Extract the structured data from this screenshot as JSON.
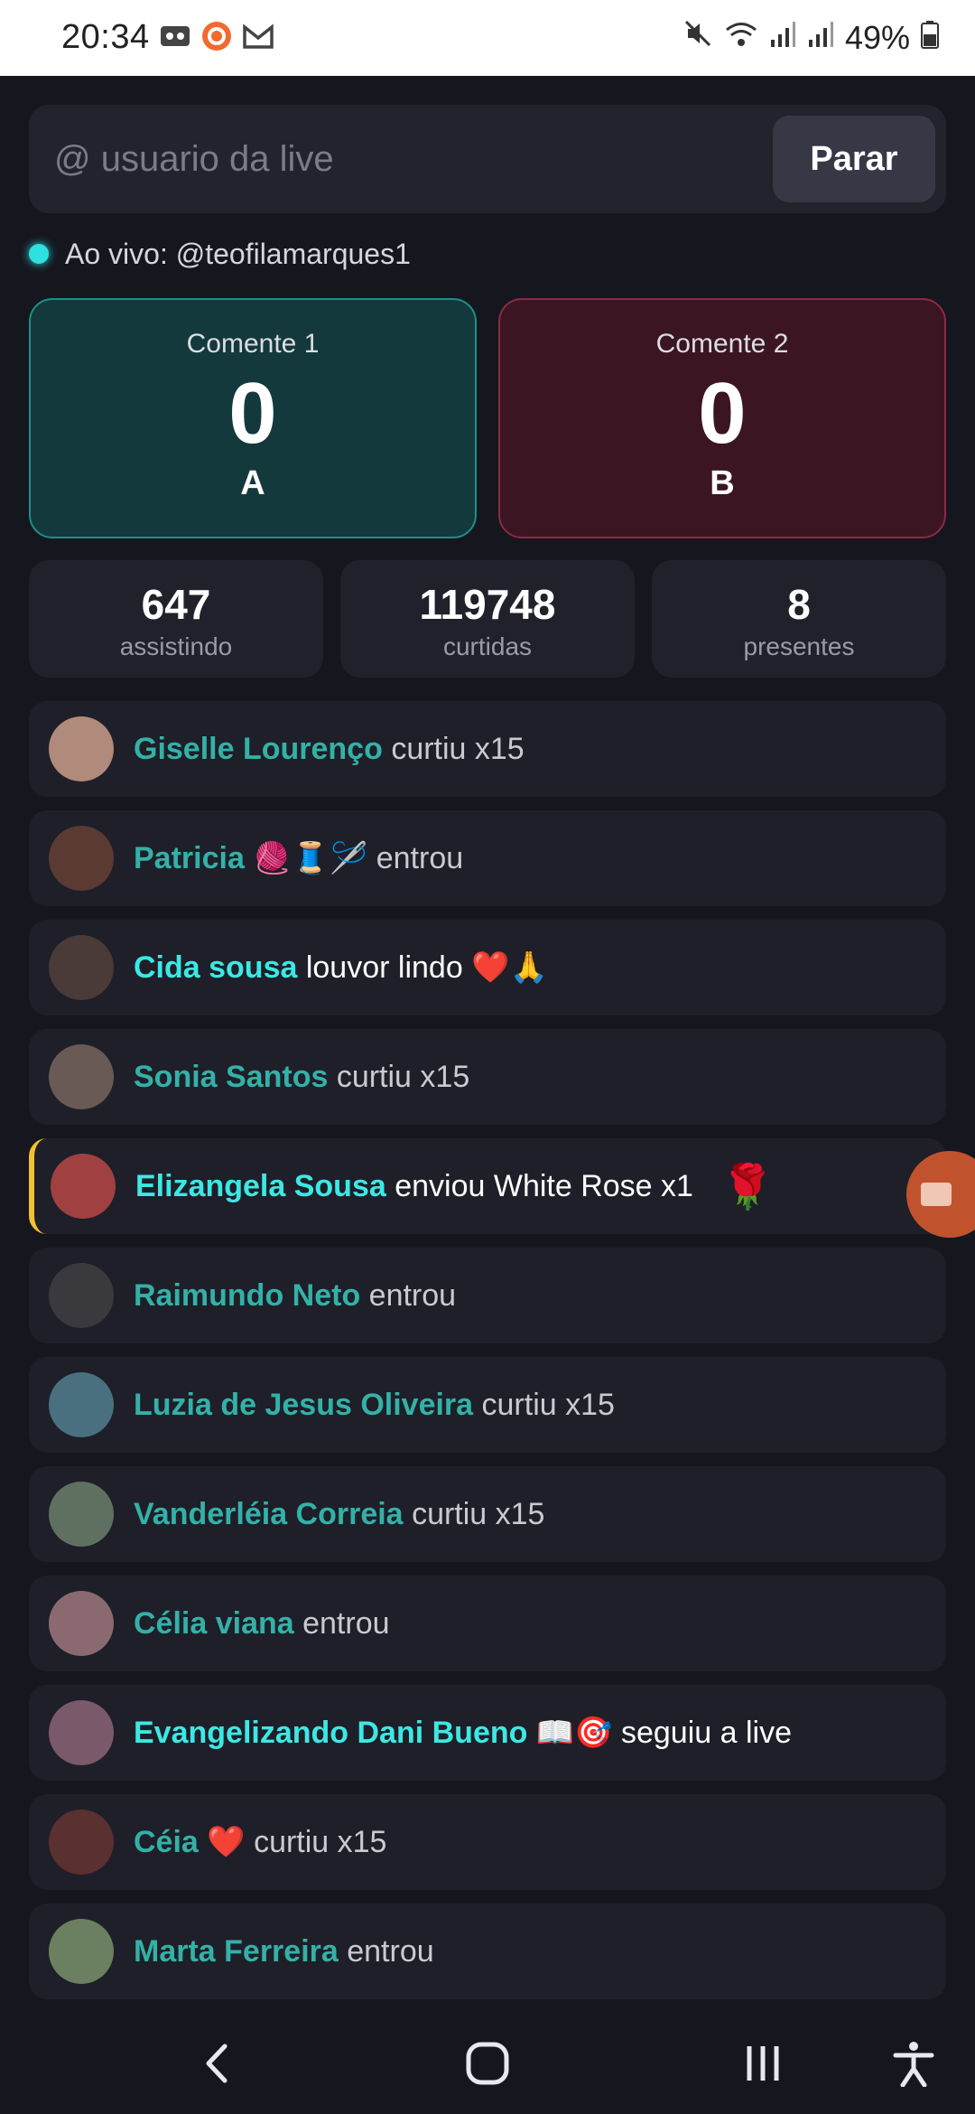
{
  "status_bar": {
    "time": "20:34",
    "battery": "49%",
    "left_icons": [
      "voicemail-icon",
      "app-notification-icon",
      "gmail-icon"
    ],
    "right_icons": [
      "mute-icon",
      "wifi-icon",
      "signal-icon",
      "signal-icon",
      "battery-icon"
    ]
  },
  "search": {
    "placeholder": "@ usuario da live",
    "value": "",
    "stop_label": "Parar"
  },
  "live": {
    "text": "Ao vivo: @teofilamarques1",
    "dot_color": "#2ee0e0"
  },
  "teams": [
    {
      "label": "Comente 1",
      "score": "0",
      "letter": "A",
      "color": "#1f8e8a"
    },
    {
      "label": "Comente 2",
      "score": "0",
      "letter": "B",
      "color": "#8b2a44"
    }
  ],
  "stats": [
    {
      "value": "647",
      "label": "assistindo"
    },
    {
      "value": "119748",
      "label": "curtidas"
    },
    {
      "value": "8",
      "label": "presentes"
    }
  ],
  "feed": [
    {
      "name": "Giselle Lourenço",
      "action": "curtiu x15",
      "type": "like",
      "avatar_color": "#b08a7a"
    },
    {
      "name": "Patricia 🧶🧵🪡",
      "action": "entrou",
      "type": "join",
      "avatar_color": "#5a3a32"
    },
    {
      "name": "Cida sousa",
      "action": "louvor lindo ❤️🙏",
      "type": "comment",
      "avatar_color": "#4a3a38"
    },
    {
      "name": "Sonia Santos",
      "action": "curtiu x15",
      "type": "like",
      "avatar_color": "#6a5a55"
    },
    {
      "name": "Elizangela Sousa",
      "action": "enviou White Rose x1",
      "type": "gift",
      "gift_icon": "🌹",
      "avatar_color": "#a04040"
    },
    {
      "name": "Raimundo Neto",
      "action": "entrou",
      "type": "join",
      "avatar_color": "#3a3a3e"
    },
    {
      "name": "Luzia de Jesus Oliveira",
      "action": "curtiu x15",
      "type": "like",
      "avatar_color": "#4a7080"
    },
    {
      "name": "Vanderléia Correia",
      "action": "curtiu x15",
      "type": "like",
      "avatar_color": "#607060"
    },
    {
      "name": "Célia viana",
      "action": "entrou",
      "type": "join",
      "avatar_color": "#8a6a70"
    },
    {
      "name": "Evangelizando Dani Bueno 📖🎯",
      "action": "seguiu a live",
      "type": "follow",
      "avatar_color": "#7a5a6a"
    },
    {
      "name": "Céia ❤️",
      "action": "curtiu x15",
      "type": "like",
      "avatar_color": "#5a3030"
    },
    {
      "name": "Marta Ferreira",
      "action": "entrou",
      "type": "join",
      "avatar_color": "#6a8060"
    }
  ],
  "floating_button": {
    "icon": "video-camera-icon",
    "color": "#c0532d"
  },
  "nav": [
    "back-icon",
    "home-icon",
    "recents-icon",
    "accessibility-icon"
  ]
}
